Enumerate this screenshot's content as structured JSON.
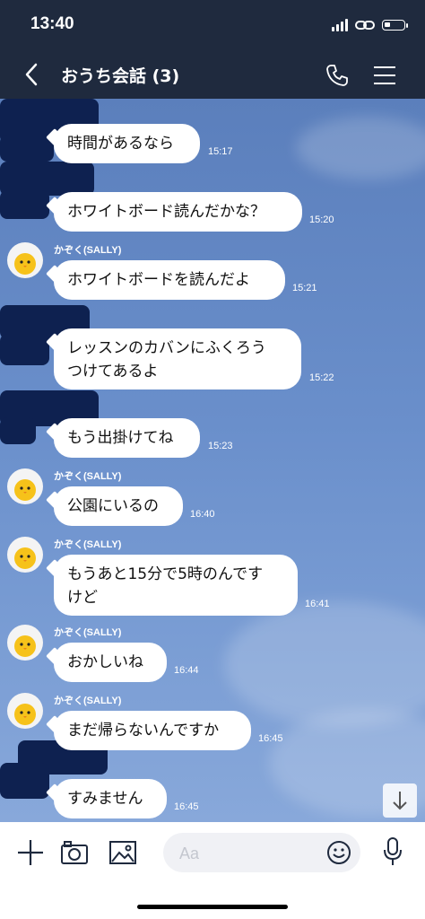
{
  "status_bar": {
    "time": "13:40",
    "battery_level": 0.3
  },
  "header": {
    "title": "おうち会話 (3)",
    "back_icon": "chevron-left-icon",
    "call_icon": "phone-icon",
    "menu_icon": "hamburger-menu-icon"
  },
  "messages": [
    {
      "text": "時間があるなら",
      "time": "15:17"
    },
    {
      "text": "ホワイトボード読んだかな？",
      "time": "15:20"
    },
    {
      "sender": "かぞく(SALLY)",
      "text": "ホワイトボードを読んだよ",
      "time": "15:21"
    },
    {
      "text_line1": "レッスンのカバンにふくろう",
      "text_line2": "つけてあるよ",
      "time": "15:22"
    },
    {
      "text": "もう出掛けてね",
      "time": "15:23"
    },
    {
      "sender": "かぞく(SALLY)",
      "text": "公園にいるの",
      "time": "16:40"
    },
    {
      "sender": "かぞく(SALLY)",
      "text_line1": "もうあと15分で5時のんです",
      "text_line2": "けど",
      "time": "16:41"
    },
    {
      "sender": "かぞく(SALLY)",
      "text": "おかしいね",
      "time": "16:44"
    },
    {
      "sender": "かぞく(SALLY)",
      "text": "まだ帰らないんですか",
      "time": "16:45"
    },
    {
      "text": "すみません",
      "time": "16:45"
    }
  ],
  "input": {
    "placeholder": "Aa"
  },
  "colors": {
    "header_bg": "#1f2a3e",
    "chat_bg": "#6a8fcb",
    "bubble": "#ffffff"
  }
}
